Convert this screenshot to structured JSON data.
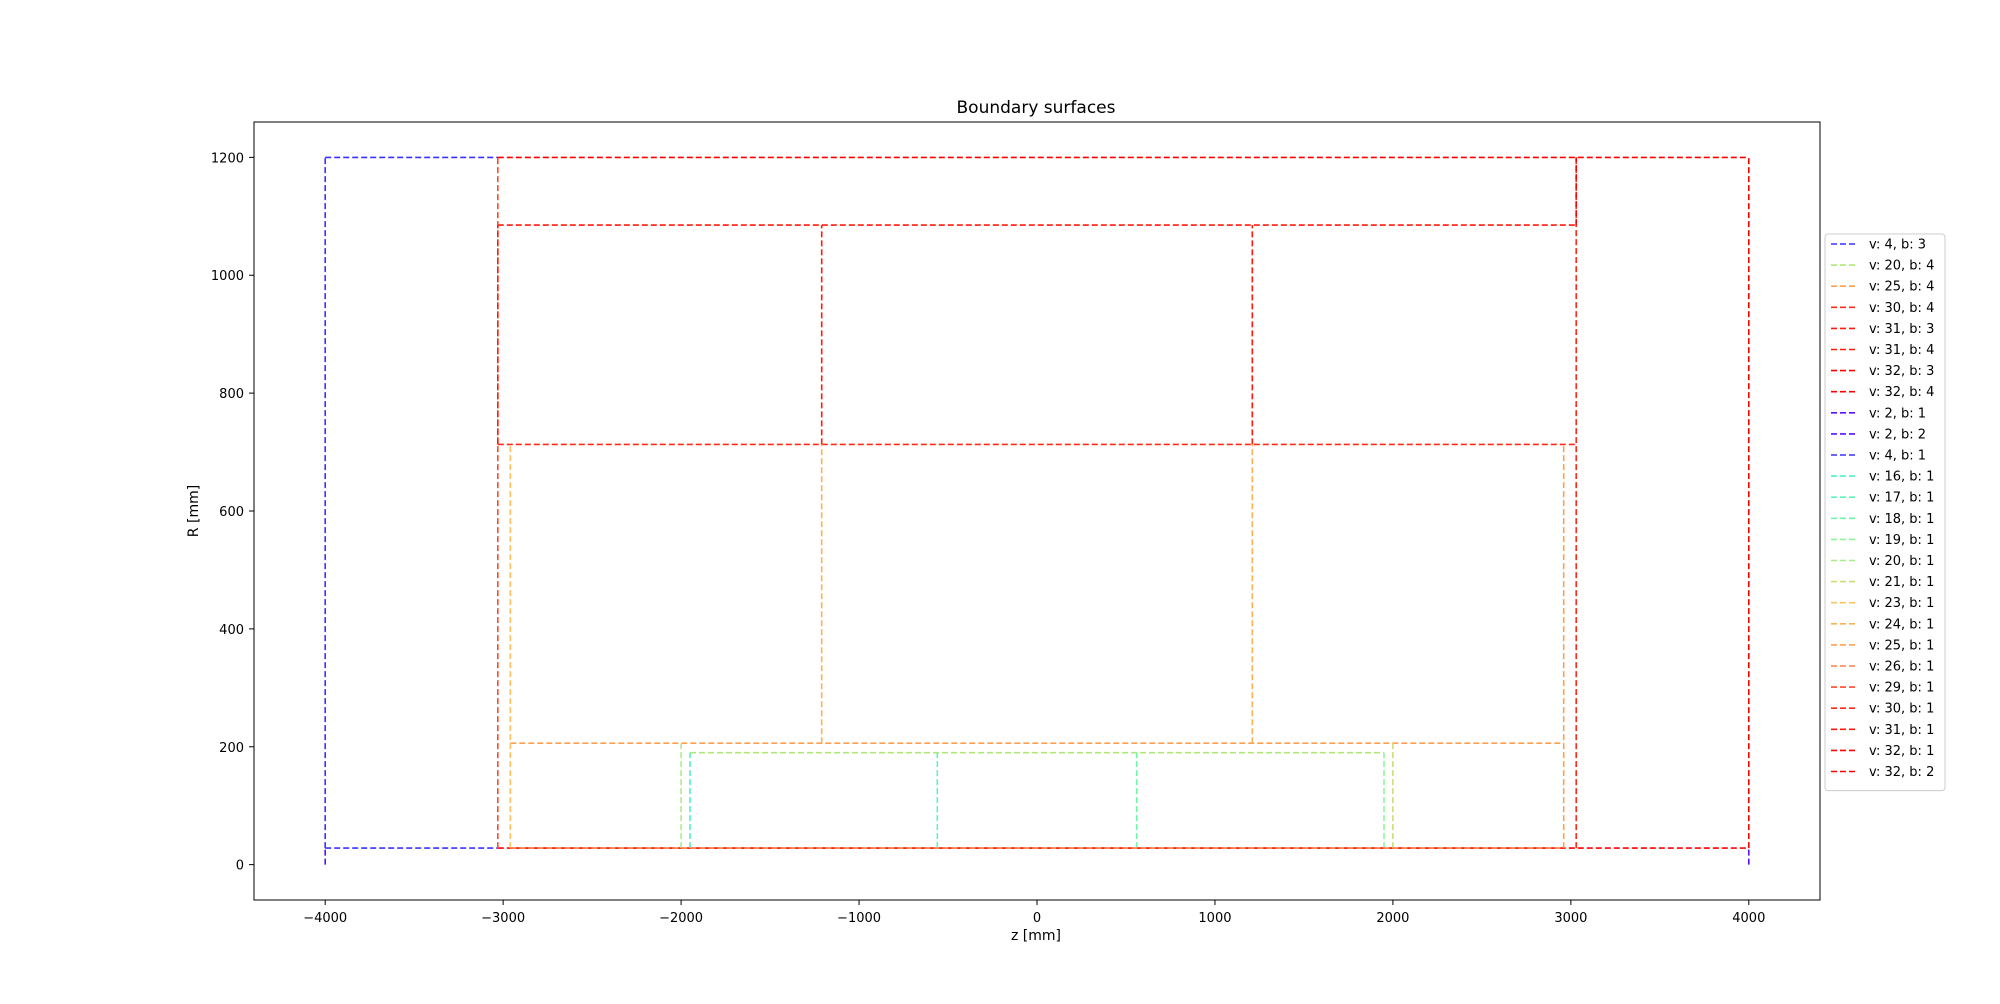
{
  "chart_data": {
    "type": "line",
    "title": "Boundary surfaces",
    "xlabel": "z [mm]",
    "ylabel": "R [mm]",
    "xlim": [
      -4400,
      4400
    ],
    "ylim": [
      -60,
      1260
    ],
    "xticks": [
      -4000,
      -3000,
      -2000,
      -1000,
      0,
      1000,
      2000,
      3000,
      4000
    ],
    "xtick_labels": [
      "−4000",
      "−3000",
      "−2000",
      "−1000",
      "0",
      "1000",
      "2000",
      "3000",
      "4000"
    ],
    "yticks": [
      0,
      200,
      400,
      600,
      800,
      1000,
      1200
    ],
    "ytick_labels": [
      "0",
      "200",
      "400",
      "600",
      "800",
      "1000",
      "1200"
    ],
    "grid": false,
    "legend_position": "right, outside plot",
    "line_style": "dashed",
    "series": [
      {
        "name": "v: 4, b: 3",
        "color": "#3a33ff",
        "segments": [
          [
            [
              -4000,
              1200
            ],
            [
              -3030,
              1200
            ]
          ]
        ]
      },
      {
        "name": "v: 20, b: 4",
        "color": "#b0e878",
        "segments": [
          [
            [
              -1950,
              190
            ],
            [
              1950,
              190
            ]
          ]
        ]
      },
      {
        "name": "v: 25, b: 4",
        "color": "#ffa050",
        "segments": [
          [
            [
              -2960,
              206
            ],
            [
              2960,
              206
            ]
          ]
        ]
      },
      {
        "name": "v: 30, b: 4",
        "color": "#ff2a18",
        "segments": [
          [
            [
              -3030,
              713
            ],
            [
              3030,
              713
            ]
          ]
        ]
      },
      {
        "name": "v: 31, b: 3",
        "color": "#ff1a0c",
        "segments": [
          [
            [
              -3030,
              1085
            ],
            [
              3030,
              1085
            ]
          ]
        ]
      },
      {
        "name": "v: 31, b: 4",
        "color": "#ff1a0c",
        "segments": [
          [
            [
              -1210,
              713
            ],
            [
              -1210,
              1085
            ]
          ],
          [
            [
              1210,
              713
            ],
            [
              1210,
              1085
            ]
          ]
        ]
      },
      {
        "name": "v: 32, b: 3",
        "color": "#ff0000",
        "segments": [
          [
            [
              -3030,
              1200
            ],
            [
              4000,
              1200
            ]
          ]
        ]
      },
      {
        "name": "v: 32, b: 4",
        "color": "#ff0000",
        "segments": [
          [
            [
              -3030,
              28
            ],
            [
              4000,
              28
            ]
          ]
        ]
      },
      {
        "name": "v: 2, b: 1",
        "color": "#5a10ff",
        "segments": [
          [
            [
              -4000,
              0
            ],
            [
              -4000,
              28
            ]
          ]
        ]
      },
      {
        "name": "v: 2, b: 2",
        "color": "#5a10ff",
        "segments": [
          [
            [
              4000,
              0
            ],
            [
              4000,
              28
            ]
          ]
        ]
      },
      {
        "name": "v: 4, b: 1",
        "color": "#3a33ff",
        "segments": [
          [
            [
              -4000,
              28
            ],
            [
              -4000,
              1200
            ]
          ],
          [
            [
              -4000,
              28
            ],
            [
              -3030,
              28
            ]
          ]
        ]
      },
      {
        "name": "v: 16, b: 1",
        "color": "#50f0c8",
        "segments": [
          [
            [
              -1950,
              28
            ],
            [
              -1950,
              190
            ]
          ]
        ]
      },
      {
        "name": "v: 17, b: 1",
        "color": "#60f4b8",
        "segments": [
          [
            [
              -560,
              28
            ],
            [
              -560,
              190
            ]
          ]
        ]
      },
      {
        "name": "v: 18, b: 1",
        "color": "#70f6a8",
        "segments": [
          [
            [
              560,
              28
            ],
            [
              560,
              190
            ]
          ]
        ]
      },
      {
        "name": "v: 19, b: 1",
        "color": "#90f498",
        "segments": [
          [
            [
              1950,
              28
            ],
            [
              1950,
              190
            ]
          ]
        ]
      },
      {
        "name": "v: 20, b: 1",
        "color": "#a8ee88",
        "segments": [
          [
            [
              -2000,
              28
            ],
            [
              -2000,
              206
            ]
          ]
        ]
      },
      {
        "name": "v: 21, b: 1",
        "color": "#c8e070",
        "segments": [
          [
            [
              2000,
              28
            ],
            [
              2000,
              206
            ]
          ]
        ]
      },
      {
        "name": "v: 23, b: 1",
        "color": "#ffc060",
        "segments": [
          [
            [
              -2960,
              28
            ],
            [
              -2960,
              713
            ]
          ]
        ]
      },
      {
        "name": "v: 24, b: 1",
        "color": "#ffb055",
        "segments": [
          [
            [
              -1210,
              206
            ],
            [
              -1210,
              713
            ]
          ],
          [
            [
              1210,
              206
            ],
            [
              1210,
              713
            ]
          ]
        ]
      },
      {
        "name": "v: 25, b: 1",
        "color": "#ffa050",
        "segments": [
          [
            [
              2960,
              28
            ],
            [
              2960,
              713
            ]
          ]
        ]
      },
      {
        "name": "v: 26, b: 1",
        "color": "#ff8040",
        "segments": [
          [
            [
              -2960,
              28
            ],
            [
              2960,
              28
            ]
          ]
        ]
      },
      {
        "name": "v: 29, b: 1",
        "color": "#ff4a2a",
        "segments": [
          [
            [
              -3030,
              28
            ],
            [
              -3030,
              1200
            ]
          ]
        ]
      },
      {
        "name": "v: 30, b: 1",
        "color": "#ff2a18",
        "segments": [
          [
            [
              3030,
              28
            ],
            [
              3030,
              1200
            ]
          ]
        ]
      },
      {
        "name": "v: 31, b: 1",
        "color": "#ff1a0c",
        "segments": [
          [
            [
              -3030,
              713
            ],
            [
              -3030,
              1085
            ]
          ]
        ]
      },
      {
        "name": "v: 32, b: 1",
        "color": "#ff0000",
        "segments": [
          [
            [
              4000,
              28
            ],
            [
              4000,
              1200
            ]
          ]
        ]
      },
      {
        "name": "v: 32, b: 2",
        "color": "#ff0000",
        "segments": [
          [
            [
              3030,
              1085
            ],
            [
              3030,
              1200
            ]
          ]
        ]
      }
    ]
  }
}
